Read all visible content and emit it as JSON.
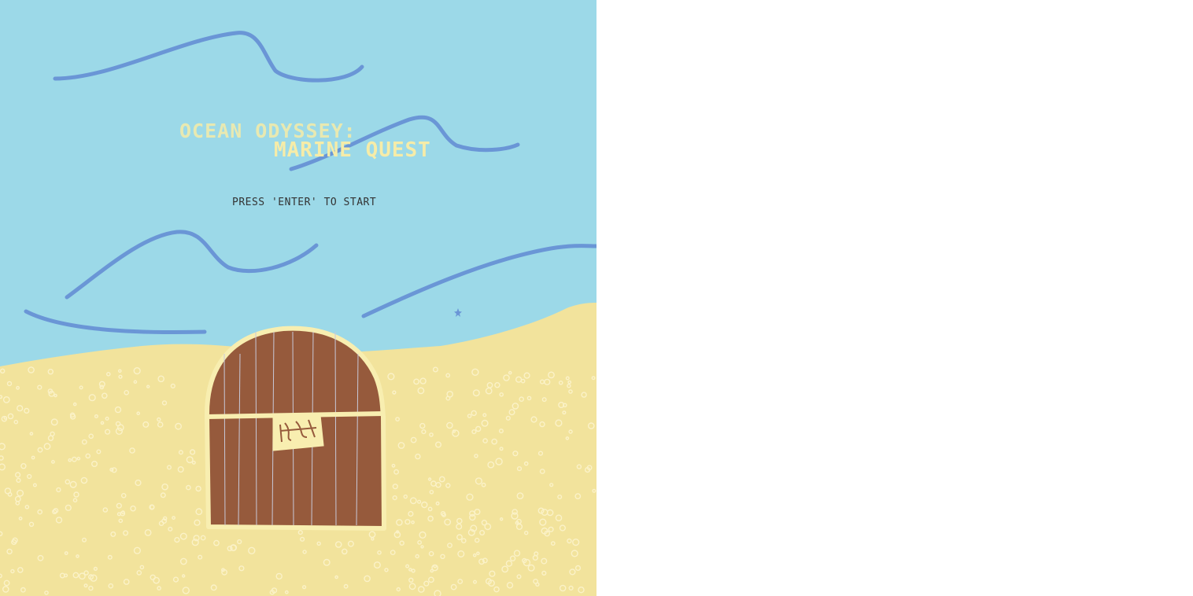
{
  "title": {
    "line1": "OCEAN ODYSSEY:",
    "line2": "MARINE QUEST"
  },
  "start_prompt": "PRESS 'ENTER' TO START",
  "colors": {
    "sky": "#9cd9e8",
    "wave": "#6a96d6",
    "sand": "#f2e39c",
    "sand_speck": "#fbf2c8",
    "chest_wood": "#965a3c",
    "chest_trim": "#f8eeb0",
    "title_text": "#f6eca8",
    "prompt_text": "#333333",
    "page_bg": "#ffffff"
  },
  "icons": {
    "chest": "treasure-chest-icon",
    "lock": "padlock-icon",
    "star": "star-icon"
  }
}
